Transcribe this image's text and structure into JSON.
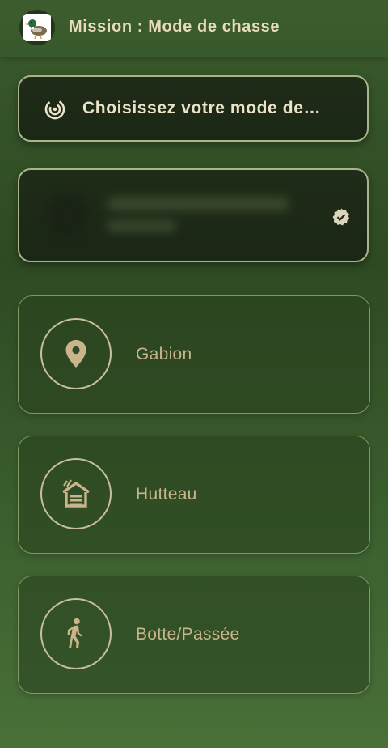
{
  "header": {
    "title": "Mission : Mode de chasse",
    "logo_icon": "duck-logo-icon"
  },
  "selector": {
    "icon": "radar-icon",
    "label": "Choisissez votre mode de…"
  },
  "profile": {
    "badge_icon": "verified-badge-icon"
  },
  "modes": [
    {
      "label": "Gabion",
      "icon": "location-pin-icon"
    },
    {
      "label": "Hutteau",
      "icon": "hut-icon"
    },
    {
      "label": "Botte/Passée",
      "icon": "walking-icon"
    }
  ],
  "colors": {
    "background": "#3a5a2c",
    "accent_text": "#c8b58c",
    "title_text": "#e8dbbd",
    "card_border": "#a8b48a"
  }
}
